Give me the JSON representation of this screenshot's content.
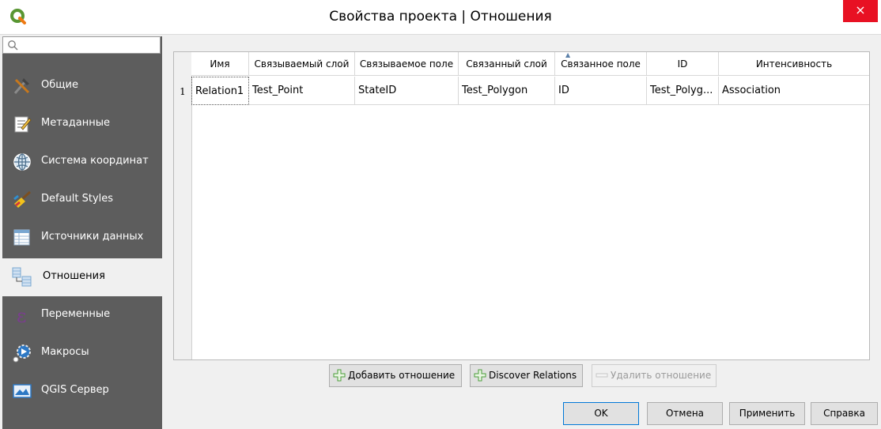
{
  "window": {
    "title": "Свойства проекта | Отношения",
    "close_label": "×"
  },
  "sidebar": {
    "items": [
      {
        "label": "Общие",
        "icon": "tools-icon"
      },
      {
        "label": "Метаданные",
        "icon": "metadata-icon"
      },
      {
        "label": "Система координат",
        "icon": "globe-icon"
      },
      {
        "label": "Default Styles",
        "icon": "paint-brush-icon"
      },
      {
        "label": "Источники данных",
        "icon": "data-sources-icon"
      },
      {
        "label": "Отношения",
        "icon": "relations-icon",
        "active": true
      },
      {
        "label": "Переменные",
        "icon": "variables-icon"
      },
      {
        "label": "Макросы",
        "icon": "macros-icon"
      },
      {
        "label": "QGIS Сервер",
        "icon": "server-icon"
      }
    ]
  },
  "table": {
    "columns": [
      "Имя",
      "Связываемый слой",
      "Связываемое поле",
      "Связанный слой",
      "Связанное поле",
      "ID",
      "Интенсивность"
    ],
    "sorted_column": "Связанное поле",
    "rows": [
      {
        "num": "1",
        "cells": [
          "Relation1",
          "Test_Point",
          "StateID",
          "Test_Polygon",
          "ID",
          "Test_Polyg...",
          "Association"
        ]
      }
    ]
  },
  "actions": {
    "add_relation": "Добавить отношение",
    "discover_relations": "Discover Relations",
    "remove_relation": "Удалить отношение"
  },
  "dialog_buttons": {
    "ok": "OK",
    "cancel": "Отмена",
    "apply": "Применить",
    "help": "Справка"
  },
  "colors": {
    "sidebar_bg": "#5d5d5d",
    "close_button": "#e81123",
    "qgis_green": "#589632",
    "add_icon_green": "#4a9d3a"
  }
}
